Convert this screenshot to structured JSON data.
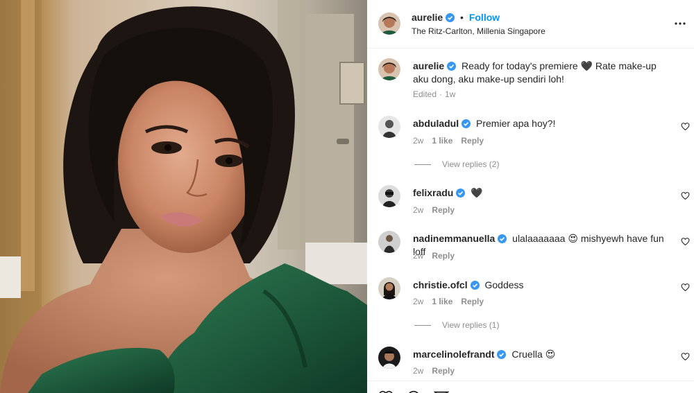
{
  "post": {
    "author": "aurelie",
    "follow_label": "Follow",
    "separator": "•",
    "location": "The Ritz-Carlton, Millenia Singapore",
    "more_icon": "more-horizontal-icon"
  },
  "caption": {
    "username": "aurelie",
    "text": "Ready for today's premiere 🖤 Rate make-up aku dong, aku make-up sendiri loh!",
    "edited": "Edited",
    "time": "1w"
  },
  "comments": [
    {
      "username": "abduladul",
      "text": "Premier apa hoy?!",
      "time": "2w",
      "likes": "1 like",
      "reply": "Reply",
      "view_replies": "View replies (2)"
    },
    {
      "username": "felixradu",
      "text": "🖤",
      "time": "2w",
      "likes": "",
      "reply": "Reply",
      "view_replies": ""
    },
    {
      "username": "nadinemmanuella",
      "text": "ulalaaaaaaa 😍 mishyewh have fun loff",
      "time": "2w",
      "likes": "",
      "reply": "Reply",
      "view_replies": ""
    },
    {
      "username": "christie.ofcl",
      "text": "Goddess",
      "time": "2w",
      "likes": "1 like",
      "reply": "Reply",
      "view_replies": "View replies (1)"
    },
    {
      "username": "marcelinolefrandt",
      "text": "Cruella 😍",
      "time": "2w",
      "likes": "",
      "reply": "Reply",
      "view_replies": ""
    }
  ],
  "colors": {
    "link_blue": "#0095f6",
    "verified_blue": "#3897f0",
    "secondary_text": "#8e8e8e",
    "dress_green": "#1f5b3d"
  }
}
